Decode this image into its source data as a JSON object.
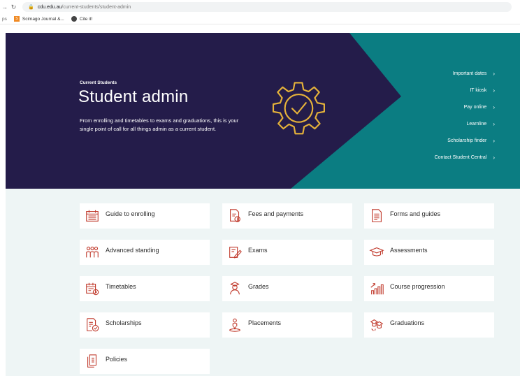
{
  "browser": {
    "url_host": "cdu.edu.au",
    "url_path": "/current-students/student-admin",
    "bookmarks": {
      "apps_label": "ps",
      "item1": "Scimago Journal &...",
      "item2": "Cite it!"
    }
  },
  "hero": {
    "eyebrow": "Current Students",
    "title": "Student admin",
    "description": "From enrolling and timetables to exams and graduations, this is your single point of call for all things admin as a current student.",
    "links": [
      "Important dates",
      "IT kiosk",
      "Pay online",
      "Learnline",
      "Scholarship finder",
      "Contact Student Central"
    ]
  },
  "tiles": [
    "Guide to enrolling",
    "Fees and payments",
    "Forms and guides",
    "Advanced standing",
    "Exams",
    "Assessments",
    "Timetables",
    "Grades",
    "Course progression",
    "Scholarships",
    "Placements",
    "Graduations",
    "Policies"
  ],
  "colors": {
    "hero_navy": "#241c4a",
    "hero_teal": "#0b7d82",
    "gear_gold": "#e5b23a",
    "icon_red": "#c0392b",
    "tile_bg": "#eef5f5"
  }
}
